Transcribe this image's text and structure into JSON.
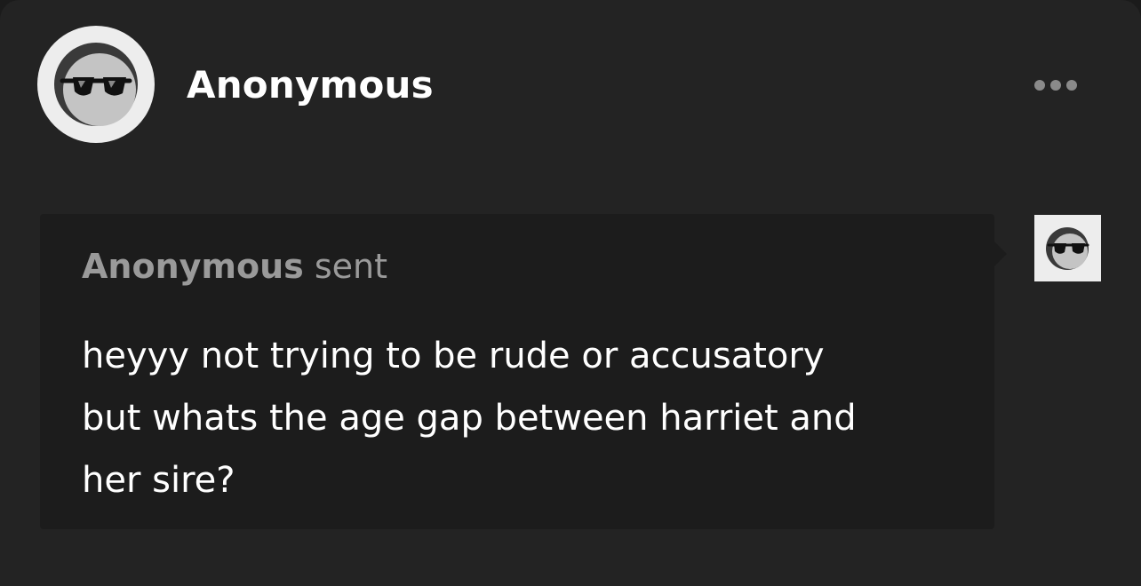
{
  "post": {
    "username": "Anonymous",
    "avatar_icon": "anonymous-sunglasses-icon",
    "more_icon": "more-options-icon"
  },
  "ask": {
    "sender": "Anonymous",
    "sent_label": "sent",
    "asker_avatar_icon": "anonymous-sunglasses-icon",
    "body_lines": [
      "heyyy not trying to be rude or accusatory",
      "but whats the age gap between harriet and",
      "her sire?"
    ]
  },
  "colors": {
    "card_background": "#232323",
    "bubble_background": "#1c1c1c",
    "secondary_text": "#9a9a9a",
    "primary_text": "#ffffff"
  }
}
